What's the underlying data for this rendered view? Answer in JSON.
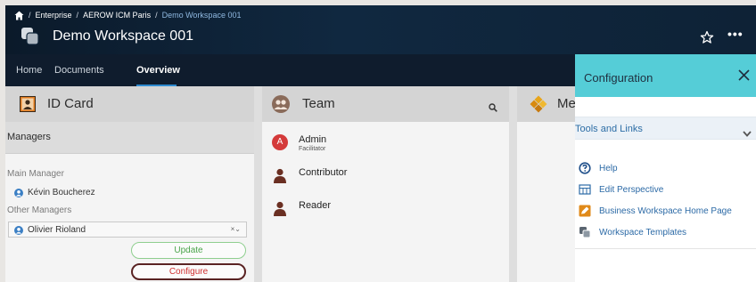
{
  "breadcrumb": {
    "items": [
      "Enterprise",
      "AEROW ICM Paris"
    ],
    "current": "Demo Workspace 001",
    "separator": "/"
  },
  "workspace": {
    "title": "Demo Workspace 001"
  },
  "header_actions": {
    "more_label": "•••"
  },
  "tabs": [
    {
      "label": "Home"
    },
    {
      "label": "Documents"
    },
    {
      "label": "Overview"
    }
  ],
  "id_card": {
    "title": "ID Card",
    "section": "Managers",
    "main_manager_label": "Main Manager",
    "main_manager": "Kévin Boucherez",
    "other_managers_label": "Other Managers",
    "other_manager_value": "Olivier Rioland",
    "select_controls": "×⌄",
    "update_label": "Update",
    "configure_label": "Configure"
  },
  "team": {
    "title": "Team",
    "members": [
      {
        "initial": "A",
        "name": "Admin",
        "role": "Facilitator"
      },
      {
        "name": "Contributor"
      },
      {
        "name": "Reader"
      }
    ]
  },
  "third_column": {
    "title": "Me"
  },
  "configuration": {
    "title": "Configuration",
    "section": "Tools and Links",
    "links": [
      {
        "label": "Help",
        "icon": "help-icon"
      },
      {
        "label": "Edit Perspective",
        "icon": "perspective-icon"
      },
      {
        "label": "Business Workspace Home Page",
        "icon": "home-page-icon"
      },
      {
        "label": "Workspace Templates",
        "icon": "templates-icon"
      }
    ]
  },
  "colors": {
    "header_bg": "#102840",
    "tabs_bg": "#0f1c2d",
    "config_header": "#55cdd7",
    "link": "#2c6aa6",
    "update_green": "#4aa44a",
    "configure_red": "#d03030",
    "avatar_red": "#d43a3a"
  }
}
